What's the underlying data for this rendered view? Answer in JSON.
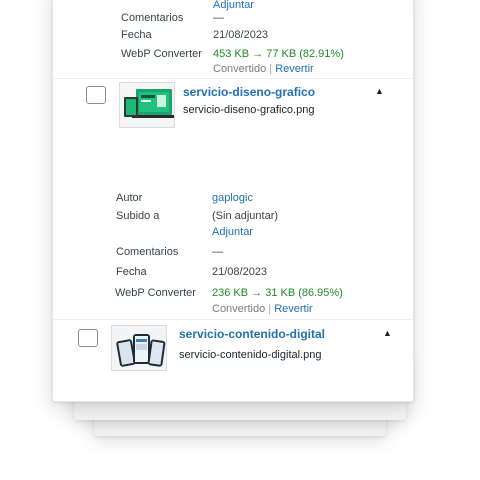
{
  "item_prev": {
    "attach_link": "Adjuntar",
    "comments_label": "Comentarios",
    "comments_value": "—",
    "date_label": "Fecha",
    "date_value": "21/08/2023",
    "webp_label": "WebP Converter",
    "webp_value": "453 KB → 77 KB (82.91%)",
    "converted": "Convertido",
    "separator": "|",
    "revert": "Revertir"
  },
  "item_1": {
    "title": "servicio-diseno-grafico",
    "filename": "servicio-diseno-grafico.png",
    "caret": "▲",
    "author_label": "Autor",
    "author_value": "gaplogic",
    "uploaded_label": "Subido a",
    "uploaded_value": "(Sin adjuntar)",
    "attach_link": "Adjuntar",
    "comments_label": "Comentarios",
    "comments_value": "—",
    "date_label": "Fecha",
    "date_value": "21/08/2023",
    "webp_label": "WebP Converter",
    "webp_value": "236 KB → 31 KB (86.95%)",
    "converted": "Convertido",
    "separator": "|",
    "revert": "Revertir"
  },
  "item_2": {
    "title": "servicio-contenido-digital",
    "filename": "servicio-contenido-digital.png",
    "caret": "▲"
  }
}
